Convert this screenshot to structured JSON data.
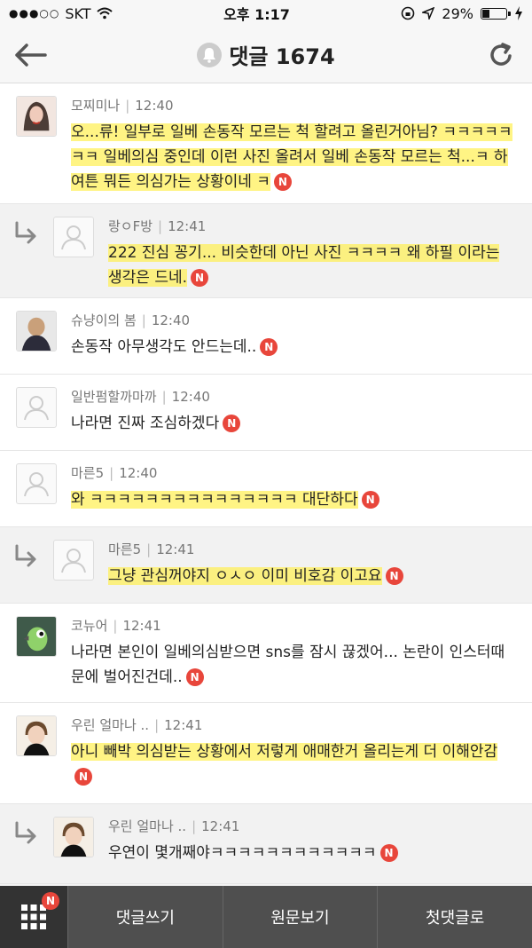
{
  "status_bar": {
    "carrier": "SKT",
    "time": "오후 1:17",
    "battery": "29%",
    "battery_level": 0.29
  },
  "header": {
    "title": "댓글 1674",
    "back_icon": "back-arrow-icon",
    "bell_icon": "bell-icon",
    "refresh_icon": "refresh-icon"
  },
  "comments": [
    {
      "author": "모찌미나",
      "time": "12:40",
      "reply": false,
      "text": "오...류! 일부로 일베 손동작 모르는 척 할려고 올린거아님? ㅋㅋㅋㅋㅋㅋㅋ 일베의심 중인데 이런 사진 올려서 일베 손동작 모르는 척...ㅋ 하여튼 뭐든 의심가는 상황이네 ㅋ",
      "badge": "N"
    },
    {
      "author": "랑ㅇF방",
      "time": "12:41",
      "reply": true,
      "text": "222 진심 꽁기... 비슷한데 아닌 사진 ㅋㅋㅋㅋ 왜 하필 이라는 생각은 드네.",
      "badge": "N"
    },
    {
      "author": "슈냥이의 봄",
      "time": "12:40",
      "reply": false,
      "text": "손동작 아무생각도 안드는데..",
      "badge": "N"
    },
    {
      "author": "일반펌할까마까",
      "time": "12:40",
      "reply": false,
      "text": "나라면 진짜 조심하겠다",
      "badge": "N"
    },
    {
      "author": "마른5",
      "time": "12:40",
      "reply": false,
      "text": "와 ㅋㅋㅋㅋㅋㅋㅋㅋㅋㅋㅋㅋㅋㅋㅋ 대단하다",
      "badge": "N"
    },
    {
      "author": "마른5",
      "time": "12:41",
      "reply": true,
      "text": "그냥 관심꺼야지 ㅇㅅㅇ 이미 비호감 이고요",
      "badge": "N"
    },
    {
      "author": "코뉴어",
      "time": "12:41",
      "reply": false,
      "text": "나라면 본인이 일베의심받으면 sns를 잠시 끊겠어... 논란이 인스터때문에 벌어진건데..",
      "badge": "N"
    },
    {
      "author": "우린 얼마나 ..",
      "time": "12:41",
      "reply": false,
      "text": "아니 빼박 의심받는 상황에서 저렇게 애매한거 올리는게 더 이해안감",
      "badge": "N"
    },
    {
      "author": "우린 얼마나 ..",
      "time": "12:41",
      "reply": true,
      "text": "우연이 몇개째야ㅋㅋㅋㅋㅋㅋㅋㅋㅋㅋㅋㅋ",
      "badge": "N"
    }
  ],
  "bottom_bar": {
    "menu_badge": "N",
    "write_comment": "댓글쓰기",
    "view_original": "원문보기",
    "first_comment": "첫댓글로"
  },
  "colors": {
    "badge": "#e8463b",
    "highlight": "#ffee42",
    "bottom_bar": "#4f4f4f"
  }
}
